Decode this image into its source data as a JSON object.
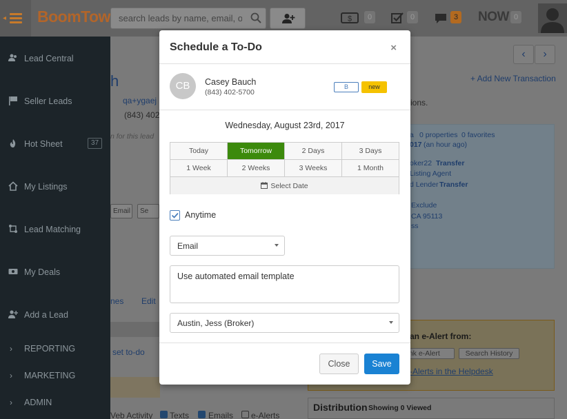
{
  "brand": {
    "logo_text": "BoomTown!",
    "accent": "#b2652a"
  },
  "search": {
    "placeholder": "search leads by name, email, or p"
  },
  "topbar": {
    "badges": [
      {
        "icon": "dollar-icon",
        "count": "0"
      },
      {
        "icon": "checkbox-icon",
        "count": "0"
      },
      {
        "icon": "chat-icon",
        "count": "3"
      }
    ],
    "now_label": "NOW",
    "now_count": "0"
  },
  "sidebar": {
    "items": [
      {
        "label": "Lead Central",
        "icon": "people-icon"
      },
      {
        "label": "Seller Leads",
        "icon": "flag-icon"
      },
      {
        "label": "Hot Sheet",
        "icon": "fire-icon",
        "count": "37"
      },
      {
        "label": "My Listings",
        "icon": "house-icon"
      },
      {
        "label": "Lead Matching",
        "icon": "match-icon"
      },
      {
        "label": "My Deals",
        "icon": "money-icon"
      },
      {
        "label": "Add a Lead",
        "icon": "add-person-icon"
      }
    ],
    "sections": [
      "REPORTING",
      "MARKETING",
      "ADMIN"
    ]
  },
  "background": {
    "name_fragment": "h",
    "email_fragment": "qa+ygaej",
    "phone_fragment": "(843) 402",
    "note_fragment": "n for this lead",
    "email_btn": "Email",
    "se_btn": "Se",
    "tabs_fragment": "nes",
    "edit_link": "Edit",
    "set_todo": "set to-do",
    "add_transaction": "+ Add New Transaction",
    "ions_fragment": "ions.",
    "properties": "0 properties",
    "favorites": "0 favorites",
    "a_fragment": "a",
    "date_fragment": "017",
    "ago": "(an hour ago)",
    "oker": "oker22",
    "transfer1": "Transfer",
    "listing_agent": "Listing Agent",
    "lender": "d Lender",
    "transfer2": "Transfer",
    "exclude": "Exclude",
    "ca_zip": "CA 95113",
    "ss": "ss",
    "ealert_title": "an e-Alert from:",
    "ank_ealert": "ank e-Alert",
    "search_history": "Search History",
    "helpdesk": "-Alerts in the Helpdesk",
    "distribution": "Distribution",
    "showing": "Showing 0 Viewed",
    "web_activity": "Veb Activity",
    "texts": "Texts",
    "emails": "Emails",
    "ealerts": "e-Alerts"
  },
  "modal": {
    "title": "Schedule a To-Do",
    "close_symbol": "×",
    "contact": {
      "initials": "CB",
      "name": "Casey Bauch",
      "phone": "(843) 402-5700",
      "grade": "B",
      "status": "new"
    },
    "date": "Wednesday, August 23rd, 2017",
    "quick": [
      [
        "Today",
        "Tomorrow",
        "2 Days",
        "3 Days"
      ],
      [
        "1 Week",
        "2 Weeks",
        "3 Weeks",
        "1 Month"
      ]
    ],
    "active_quick": "Tomorrow",
    "select_date": "Select Date",
    "anytime": "Anytime",
    "type": "Email",
    "template": "Use automated email template",
    "assignee": "Austin, Jess (Broker)",
    "close_btn": "Close",
    "save_btn": "Save"
  }
}
